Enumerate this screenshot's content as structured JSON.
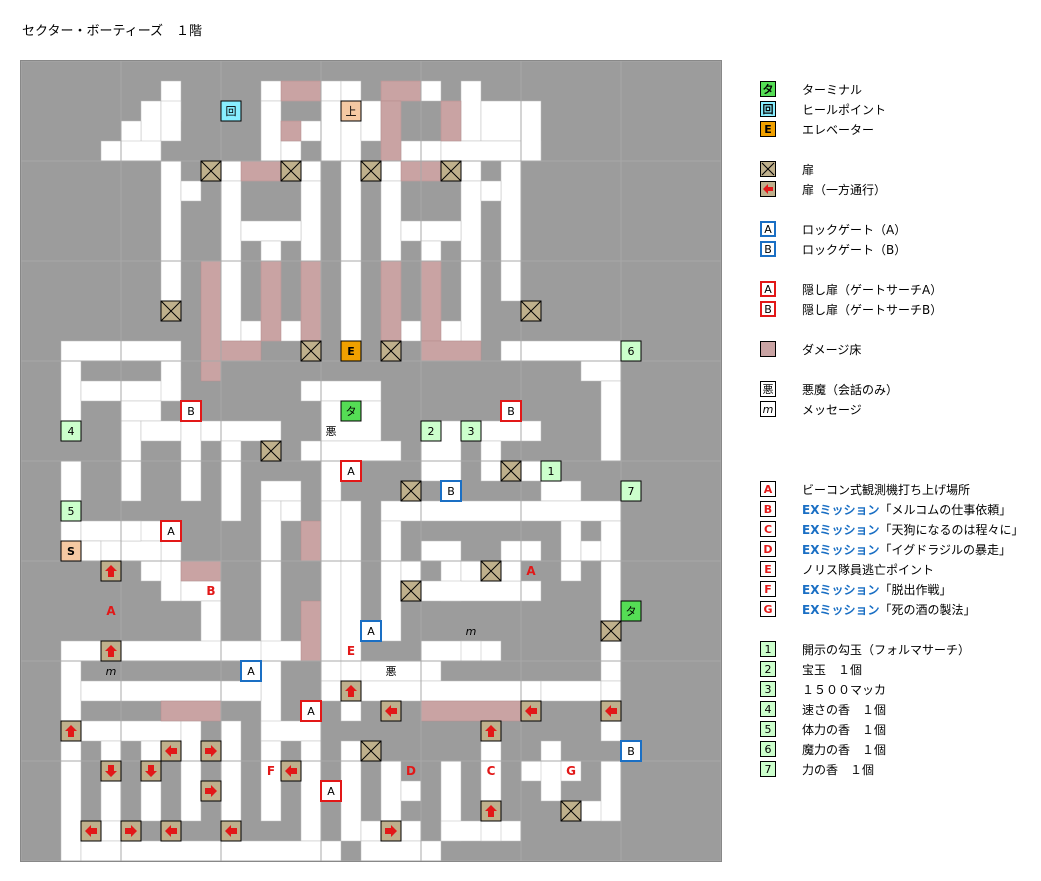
{
  "title": "セクター・ボーティーズ　１階",
  "colors": {
    "background": "#9c9c9c",
    "corridor": "#ffffff",
    "grid_line": "#bbbbbb",
    "damage_floor": "#c9a3a3",
    "door": "#bfb08c",
    "terminal": "#55dd55",
    "heal": "#88eeff",
    "elevator": "#f0a000",
    "lock_a": "#1a6fc4",
    "lock_b": "#1a6fc4",
    "hidden_door": "#e21818",
    "item": "#ccffcc",
    "stairs": "#f5c9a3",
    "one_way": "#e21818"
  },
  "legend_groups": [
    [
      {
        "icon": "terminal",
        "label": "タ",
        "text": "ターミナル"
      },
      {
        "icon": "heal",
        "label": "回",
        "text": "ヒールポイント"
      },
      {
        "icon": "elevator",
        "label": "E",
        "text": "エレベーター"
      }
    ],
    [
      {
        "icon": "door",
        "label": "",
        "text": "扉"
      },
      {
        "icon": "one-way-door",
        "label": "",
        "text": "扉（一方通行）"
      }
    ],
    [
      {
        "icon": "lock",
        "label": "A",
        "text": "ロックゲート（A）"
      },
      {
        "icon": "lock",
        "label": "B",
        "text": "ロックゲート（B）"
      }
    ],
    [
      {
        "icon": "hidden",
        "label": "A",
        "text": "隠し扉（ゲートサーチA）"
      },
      {
        "icon": "hidden",
        "label": "B",
        "text": "隠し扉（ゲートサーチB）"
      }
    ],
    [
      {
        "icon": "damage",
        "label": "",
        "text": "ダメージ床"
      }
    ],
    [
      {
        "icon": "plain",
        "label": "悪",
        "text": "悪魔（会話のみ）"
      },
      {
        "icon": "plain-italic",
        "label": "m",
        "text": "メッセージ"
      }
    ],
    [
      {
        "icon": "letter",
        "label": "A",
        "prefix": "",
        "text": "ビーコン式観測機打ち上げ場所"
      },
      {
        "icon": "letter",
        "label": "B",
        "prefix": "EXミッション",
        "text": "「メルコムの仕事依頼」"
      },
      {
        "icon": "letter",
        "label": "C",
        "prefix": "EXミッション",
        "text": "「天狗になるのは程々に」"
      },
      {
        "icon": "letter",
        "label": "D",
        "prefix": "EXミッション",
        "text": "「イグドラジルの暴走」"
      },
      {
        "icon": "letter",
        "label": "E",
        "prefix": "",
        "text": "ノリス隊員逃亡ポイント"
      },
      {
        "icon": "letter",
        "label": "F",
        "prefix": "EXミッション",
        "text": "「脱出作戦」"
      },
      {
        "icon": "letter",
        "label": "G",
        "prefix": "EXミッション",
        "text": "「死の酒の製法」"
      }
    ],
    [
      {
        "icon": "item",
        "label": "1",
        "text": "開示の勾玉（フォルマサーチ）"
      },
      {
        "icon": "item",
        "label": "2",
        "text": "宝玉　１個"
      },
      {
        "icon": "item",
        "label": "3",
        "text": "１５００マッカ"
      },
      {
        "icon": "item",
        "label": "4",
        "text": "速さの香　１個"
      },
      {
        "icon": "item",
        "label": "5",
        "text": "体力の香　１個"
      },
      {
        "icon": "item",
        "label": "6",
        "text": "魔力の香　１個"
      },
      {
        "icon": "item",
        "label": "7",
        "text": "力の香　１個"
      }
    ]
  ],
  "map": {
    "labels": {
      "heal": "回",
      "upstairs": "上",
      "elevator": "E",
      "terminal": "タ",
      "devil": "悪",
      "message": "m",
      "start": "S"
    }
  }
}
